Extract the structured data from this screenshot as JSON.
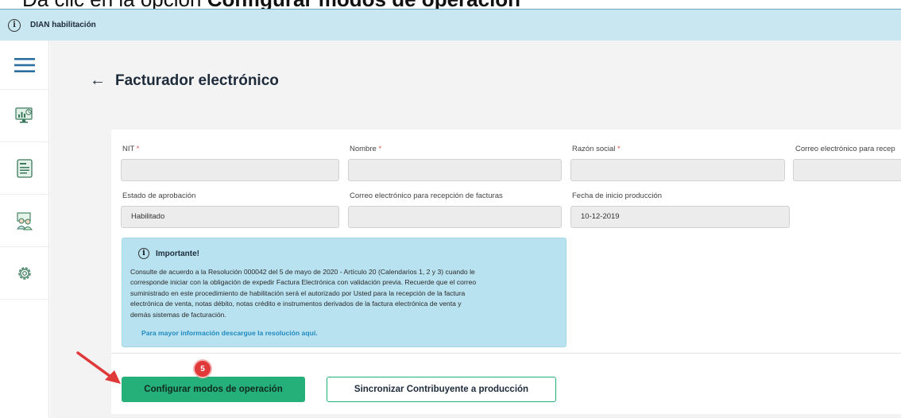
{
  "caption": {
    "prefix": "Dá clic en la opción ",
    "bold": "Configurar modos de operación"
  },
  "topbar": {
    "title": "DIAN habilitación",
    "info_icon": "i"
  },
  "sidebar": {
    "items": [
      {
        "icon": "menu-icon"
      },
      {
        "icon": "monitor-chart-icon"
      },
      {
        "icon": "document-icon"
      },
      {
        "icon": "people-icon"
      },
      {
        "icon": "gear-icon"
      }
    ]
  },
  "page": {
    "back_arrow": "←",
    "title": "Facturador electrónico"
  },
  "form": {
    "nit": {
      "label": "NIT",
      "required": "*",
      "value": ""
    },
    "nombre": {
      "label": "Nombre",
      "required": "*",
      "value": ""
    },
    "razon_social": {
      "label": "Razón social",
      "required": "*",
      "value": ""
    },
    "correo_recep_cut": {
      "label": "Correo electrónico para recep",
      "value": ""
    },
    "estado": {
      "label": "Estado de aprobación",
      "value": "Habilitado"
    },
    "correo_facturas": {
      "label": "Correo electrónico para recepción de facturas",
      "value": ""
    },
    "fecha_inicio": {
      "label": "Fecha de inicio producción",
      "value": "10-12-2019"
    }
  },
  "notice": {
    "icon": "i",
    "title": "Importante!",
    "lines": [
      "Consulte de acuerdo a la Resolución 000042 del 5 de mayo de 2020 - Artículo 20 (Calendarios 1, 2 y 3) cuando le",
      "corresponde iniciar con la obligación de expedir Factura Electrónica con validación previa. Recuerde que el correo",
      "suministrado en este procedimiento de habilitación será el autorizado por Usted para la recepción de la factura",
      "electrónica de venta, notas débito, notas crédito e instrumentos derivados de la factura electrónica de venta y",
      "demás sistemas de facturación."
    ],
    "link": "Para mayor información descargue la resolución aquí."
  },
  "actions": {
    "configure": "Configurar modos de operación",
    "sync": "Sincronizar Contribuyente a producción"
  },
  "annotation": {
    "step": "5",
    "arrow_color": "#e0393a"
  },
  "colors": {
    "topbar": "#c9e7f1",
    "accent_green": "#25b079",
    "notice_bg": "#b9e2f0",
    "link": "#1f8ac0"
  }
}
